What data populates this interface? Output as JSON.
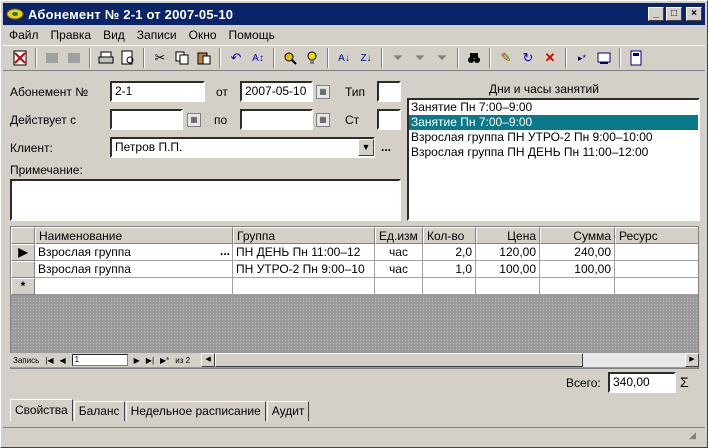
{
  "window": {
    "title": "Абонемент № 2-1 от 2007-05-10",
    "min": "_",
    "max": "□",
    "close": "×"
  },
  "menu": [
    "Файл",
    "Правка",
    "Вид",
    "Записи",
    "Окно",
    "Помощь"
  ],
  "form": {
    "abonement_label": "Абонемент №",
    "abonement_value": "2-1",
    "ot_label": "от",
    "date_value": "2007-05-10",
    "tip_label": "Тип",
    "tip_value": "",
    "valid_from_label": "Действует с",
    "valid_from_value": "",
    "po_label": "по",
    "po_value": "",
    "st_label": "Ст",
    "st_value": "",
    "client_label": "Клиент:",
    "client_value": "Петров П.П.",
    "note_label": "Примечание:",
    "note_value": "",
    "dots": "..."
  },
  "schedule": {
    "title": "Дни и часы занятий",
    "items": [
      "Занятие Пн 7:00–9:00",
      "Занятие Пн 7:00–9:00",
      "Взрослая группа ПН УТРО-2 Пн 9:00–10:00",
      "Взрослая группа ПН ДЕНЬ Пн 11:00–12:00"
    ],
    "selected_index": 1
  },
  "grid": {
    "columns": [
      "Наименование",
      "Группа",
      "Ед.изм",
      "Кол-во",
      "Цена",
      "Сумма",
      "Ресурс"
    ],
    "rows": [
      [
        "Взрослая группа",
        "ПН ДЕНЬ Пн 11:00–12",
        "час",
        "2,0",
        "120,00",
        "240,00",
        ""
      ],
      [
        "Взрослая группа",
        "ПН УТРО-2 Пн 9:00–10",
        "час",
        "1,0",
        "100,00",
        "100,00",
        ""
      ]
    ],
    "current_marker": "▶",
    "new_marker": "*",
    "ellipsis": "..."
  },
  "navigator": {
    "label": "Запись",
    "current": "1",
    "of_text": "из 2"
  },
  "total": {
    "label": "Всего:",
    "value": "340,00",
    "sigma": "Σ"
  },
  "tabs": [
    "Свойства",
    "Баланс",
    "Недельное расписание",
    "Аудит"
  ]
}
